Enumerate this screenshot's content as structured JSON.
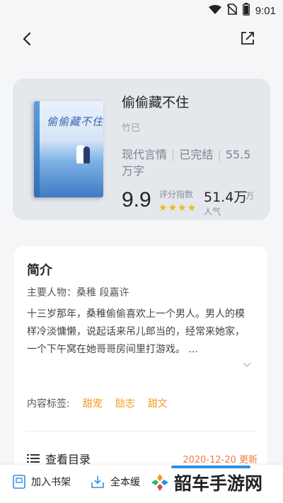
{
  "status_bar": {
    "time": "9:01"
  },
  "book": {
    "title": "偷偷藏不住",
    "author": "竹已",
    "cover_title": "偷偷藏不住",
    "category": "现代言情",
    "status": "已完结",
    "word_count": "55.5万字",
    "score": "9.9",
    "score_label": "评分指数",
    "stars": 4,
    "popularity": "51.4万",
    "popularity_unit": "万",
    "popularity_label": "人气"
  },
  "intro": {
    "title": "简介",
    "main_characters": "主要人物：桑稚 段嘉许",
    "summary": "十三岁那年，桑稚偷偷喜欢上一个男人。男人的模样冷淡慵懒，说起话来吊儿郎当的，经常来她家，一个下午窝在她哥哥房间里打游戏。 ...",
    "tags_label": "内容标签:",
    "tags": [
      "甜宠",
      "励志",
      "甜文"
    ],
    "toc_label": "查看目录",
    "update_text": "2020-12-20 更新"
  },
  "bottom_bar": {
    "add_shelf": "加入书架",
    "download_all": "全本缓"
  },
  "watermark": {
    "text": "韶车手游网"
  },
  "colors": {
    "accent": "#f09a1b",
    "star": "#f3b61a",
    "update": "#f07b3f",
    "card_bg": "#e4e7ec",
    "bar_blue": "#2f8fe6"
  },
  "icons": [
    "wifi-icon",
    "no-sim-icon",
    "battery-icon",
    "back-arrow-icon",
    "share-icon",
    "chevron-down-icon",
    "list-icon",
    "bookshelf-icon",
    "download-icon",
    "watermark-logo"
  ]
}
